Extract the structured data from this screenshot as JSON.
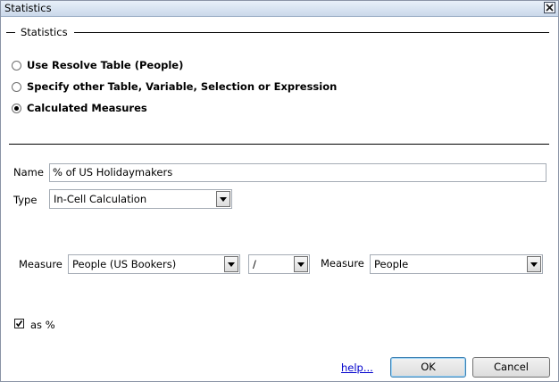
{
  "window": {
    "title": "Statistics"
  },
  "group": {
    "legend": "Statistics"
  },
  "options": [
    {
      "label": "Use Resolve Table (People)",
      "checked": false
    },
    {
      "label": "Specify other Table, Variable, Selection or Expression",
      "checked": false
    },
    {
      "label": "Calculated Measures",
      "checked": true
    }
  ],
  "form": {
    "name_label": "Name",
    "name_value": "% of US Holidaymakers",
    "type_label": "Type",
    "type_value": "In-Cell Calculation",
    "measure1_label": "Measure",
    "measure1_value": "People (US Bookers)",
    "operator_value": "/",
    "measure2_label": "Measure",
    "measure2_value": "People",
    "as_percent_label": "as %",
    "as_percent_checked": true
  },
  "footer": {
    "help_label": "help...",
    "ok_label": "OK",
    "cancel_label": "Cancel"
  }
}
